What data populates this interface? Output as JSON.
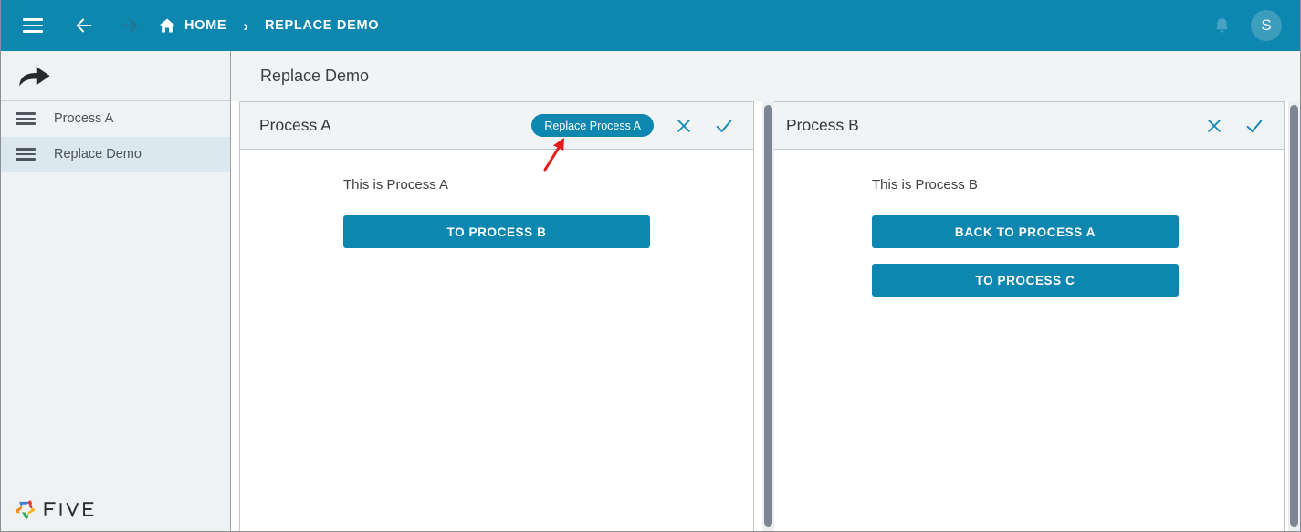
{
  "topbar": {
    "menu_icon": "hamburger-icon",
    "back_icon": "arrow-left-icon",
    "forward_icon": "arrow-right-icon",
    "home_icon": "home-icon",
    "home_label": "HOME",
    "separator": "›",
    "current_label": "REPLACE DEMO",
    "bell_icon": "bell-icon",
    "avatar_initial": "S",
    "bg_color": "#0e87b0",
    "avatar_bg": "#3c9dbd"
  },
  "sidebar": {
    "share_icon": "share-arrow-icon",
    "items": [
      {
        "label": "Process A",
        "icon": "hamburger-icon",
        "active": false
      },
      {
        "label": "Replace Demo",
        "icon": "hamburger-icon",
        "active": true
      }
    ],
    "active_bg": "#dbe8ed",
    "logo_text": "FIVE",
    "bg_color": "#eef2f3"
  },
  "page": {
    "title": "Replace Demo",
    "title_bar_bg": "#f1f4f5"
  },
  "panes": [
    {
      "title": "Process A",
      "pill_label": "Replace Process A",
      "close_icon": "close-x-icon",
      "confirm_icon": "check-icon",
      "body_text": "This is Process A",
      "buttons": [
        {
          "label": "TO PROCESS B"
        }
      ]
    },
    {
      "title": "Process B",
      "pill_label": "",
      "close_icon": "close-x-icon",
      "confirm_icon": "check-icon",
      "body_text": "This is Process B",
      "buttons": [
        {
          "label": "BACK TO PROCESS A"
        },
        {
          "label": "TO PROCESS C"
        }
      ]
    }
  ],
  "annotation": {
    "arrow_icon": "red-pointer-arrow",
    "color": "#e81c1c"
  },
  "theme": {
    "accent": "#0e87b0",
    "icon_blue": "#1a8cb4",
    "scrollbar_thumb": "#7d8493",
    "panel_border": "#c2c7cb"
  }
}
